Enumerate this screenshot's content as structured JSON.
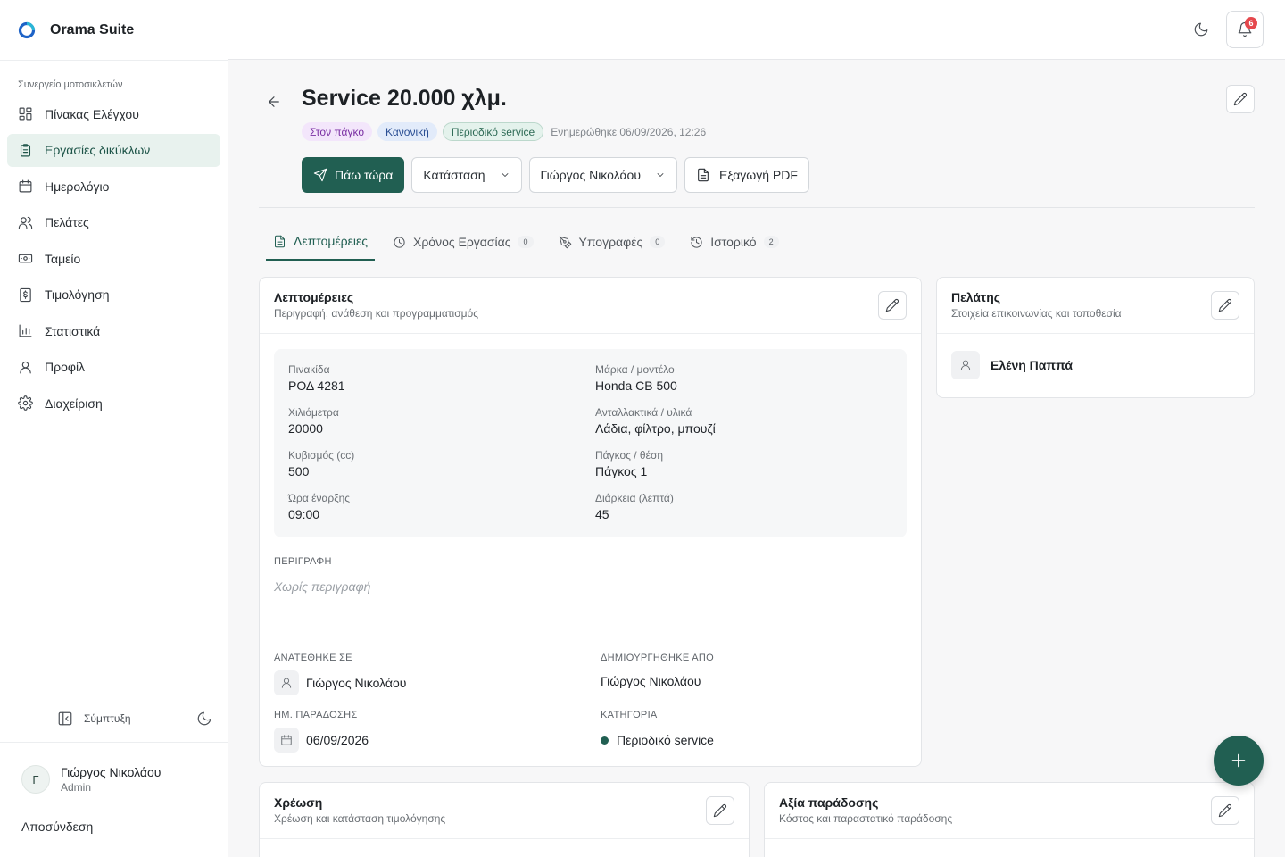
{
  "app": {
    "name": "Orama Suite"
  },
  "sidebar": {
    "section": "Συνεργείο μοτοσικλετών",
    "items": [
      {
        "label": "Πίνακας Ελέγχου",
        "icon": "dashboard-icon"
      },
      {
        "label": "Εργασίες δικύκλων",
        "icon": "clipboard-icon",
        "active": true
      },
      {
        "label": "Ημερολόγιο",
        "icon": "calendar-icon"
      },
      {
        "label": "Πελάτες",
        "icon": "users-icon"
      },
      {
        "label": "Ταμείο",
        "icon": "cash-icon"
      },
      {
        "label": "Τιμολόγηση",
        "icon": "invoice-icon"
      },
      {
        "label": "Στατιστικά",
        "icon": "chart-icon"
      },
      {
        "label": "Προφίλ",
        "icon": "user-icon"
      },
      {
        "label": "Διαχείριση",
        "icon": "settings-icon"
      }
    ],
    "collapse_label": "Σύμπτυξη",
    "user": {
      "initial": "Γ",
      "name": "Γιώργος Νικολάου",
      "role": "Admin"
    },
    "logout": "Αποσύνδεση"
  },
  "topbar": {
    "notifications_count": "6"
  },
  "header": {
    "title": "Service 20.000 χλμ.",
    "badges": [
      "Στον πάγκο",
      "Κανονική",
      "Περιοδικό service"
    ],
    "updated": "Ενημερώθηκε 06/09/2026, 12:26",
    "actions": {
      "go_now": "Πάω τώρα",
      "status": "Κατάσταση",
      "assignee": "Γιώργος Νικολάου",
      "export": "Εξαγωγή PDF"
    }
  },
  "tabs": [
    {
      "label": "Λεπτομέρειες",
      "count": ""
    },
    {
      "label": "Χρόνος Εργασίας",
      "count": "0"
    },
    {
      "label": "Υπογραφές",
      "count": "0"
    },
    {
      "label": "Ιστορικό",
      "count": "2"
    }
  ],
  "details": {
    "title": "Λεπτομέρειες",
    "subtitle": "Περιγραφή, ανάθεση και προγραμματισμός",
    "fields": [
      {
        "label": "Πινακίδα",
        "value": "ΡΟΔ 4281"
      },
      {
        "label": "Μάρκα / μοντέλο",
        "value": "Honda CB 500"
      },
      {
        "label": "Χιλιόμετρα",
        "value": "20000"
      },
      {
        "label": "Ανταλλακτικά / υλικά",
        "value": "Λάδια, φίλτρο, μπουζί"
      },
      {
        "label": "Κυβισμός (cc)",
        "value": "500"
      },
      {
        "label": "Πάγκος / θέση",
        "value": "Πάγκος 1"
      },
      {
        "label": "Ώρα έναρξης",
        "value": "09:00"
      },
      {
        "label": "Διάρκεια (λεπτά)",
        "value": "45"
      }
    ],
    "description_label": "ΠΕΡΙΓΡΑΦΗ",
    "description_value": "Χωρίς περιγραφή",
    "assigned_label": "ΑΝΑΤΕΘΗΚΕ ΣΕ",
    "assigned_value": "Γιώργος Νικολάου",
    "created_label": "ΔΗΜΙΟΥΡΓΗΘΗΚΕ ΑΠΟ",
    "created_value": "Γιώργος Νικολάου",
    "delivery_label": "ΗΜ. ΠΑΡΑΔΟΣΗΣ",
    "delivery_value": "06/09/2026",
    "category_label": "ΚΑΤΗΓΟΡΙΑ",
    "category_value": "Περιοδικό service"
  },
  "client": {
    "title": "Πελάτης",
    "subtitle": "Στοιχεία επικοινωνίας και τοποθεσία",
    "name": "Ελένη Παππά"
  },
  "charge": {
    "title": "Χρέωση",
    "subtitle": "Χρέωση και κατάσταση τιμολόγησης"
  },
  "delivery_value_card": {
    "title": "Αξία παράδοσης",
    "subtitle": "Κόστος και παραστατικό παράδοσης"
  },
  "colors": {
    "accent": "#215f52",
    "accent_light": "#e8f2ee",
    "badge_red": "#e5484d"
  }
}
